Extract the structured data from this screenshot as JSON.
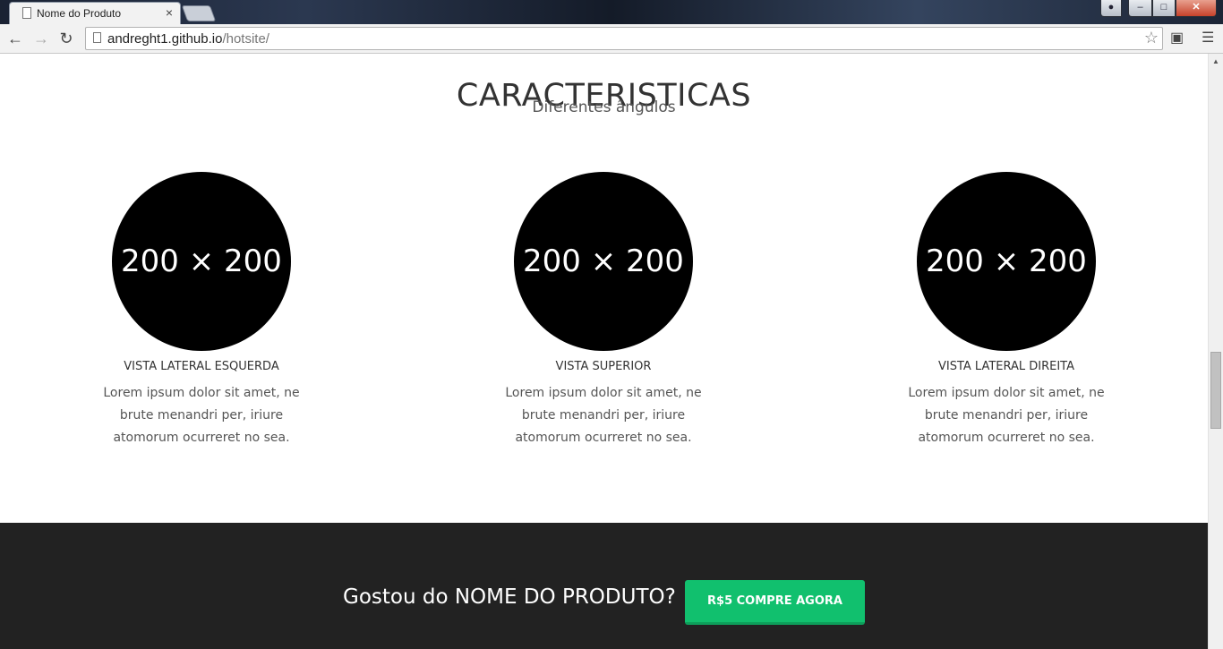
{
  "browser": {
    "tab_title": "Nome do Produto",
    "tab_close": "×",
    "url_domain": "andreght1.github.io",
    "url_path": "/hotsite/"
  },
  "page": {
    "heading": "CARACTERISTICAS",
    "subheading": "Diferentes ângulos",
    "features": [
      {
        "image_text": "200 × 200",
        "title": "VISTA LATERAL ESQUERDA",
        "text": "Lorem ipsum dolor sit amet, ne brute menandri per, iriure atomorum ocurreret no sea."
      },
      {
        "image_text": "200 × 200",
        "title": "VISTA SUPERIOR",
        "text": "Lorem ipsum dolor sit amet, ne brute menandri per, iriure atomorum ocurreret no sea."
      },
      {
        "image_text": "200 × 200",
        "title": "VISTA LATERAL DIREITA",
        "text": "Lorem ipsum dolor sit amet, ne brute menandri per, iriure atomorum ocurreret no sea."
      }
    ],
    "cta": {
      "text": "Gostou do NOME DO PRODUTO?",
      "button_label": "R$5 COMPRE AGORA",
      "button_color": "#11c06e",
      "band_color": "#222222"
    }
  }
}
